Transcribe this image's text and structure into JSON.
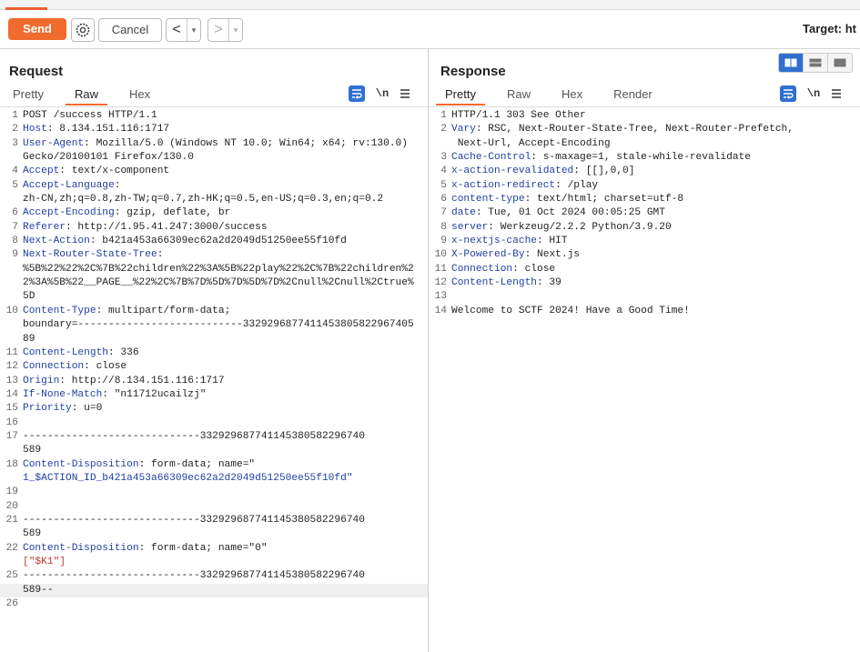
{
  "toolbar": {
    "send_label": "Send",
    "cancel_label": "Cancel",
    "back_arrow": "<",
    "forward_arrow": ">",
    "dropdown_glyph": "▾",
    "target_text": "Target: ht"
  },
  "request": {
    "title": "Request",
    "tabs": [
      "Pretty",
      "Raw",
      "Hex"
    ],
    "active_tab": "Raw",
    "newline_toggle": "\\n",
    "lines": [
      {
        "n": "1",
        "text": "POST /success HTTP/1.1"
      },
      {
        "n": "2",
        "name": "Host",
        "value": " 8.134.151.116:1717"
      },
      {
        "n": "3",
        "name": "User-Agent",
        "value": " Mozilla/5.0 (Windows NT 10.0; Win64; x64; rv:130.0) Gecko/20100101 Firefox/130.0"
      },
      {
        "n": "4",
        "name": "Accept",
        "value": " text/x-component"
      },
      {
        "n": "5",
        "name": "Accept-Language",
        "value": "\nzh-CN,zh;q=0.8,zh-TW;q=0.7,zh-HK;q=0.5,en-US;q=0.3,en;q=0.2"
      },
      {
        "n": "6",
        "name": "Accept-Encoding",
        "value": " gzip, deflate, br"
      },
      {
        "n": "7",
        "name": "Referer",
        "value": " http://1.95.41.247:3000/success"
      },
      {
        "n": "8",
        "name": "Next-Action",
        "value": " b421a453a66309ec62a2d2049d51250ee55f10fd"
      },
      {
        "n": "9",
        "name": "Next-Router-State-Tree",
        "value": "\n%5B%22%22%2C%7B%22children%22%3A%5B%22play%22%2C%7B%22children%22%3A%5B%22__PAGE__%22%2C%7B%7D%5D%7D%5D%7D%2Cnull%2Cnull%2Ctrue%5D"
      },
      {
        "n": "10",
        "name": "Content-Type",
        "value": " multipart/form-data;\nboundary=---------------------------332929687741145380582296740589"
      },
      {
        "n": "11",
        "name": "Content-Length",
        "value": " 336"
      },
      {
        "n": "12",
        "name": "Connection",
        "value": " close"
      },
      {
        "n": "13",
        "name": "Origin",
        "value": " http://8.134.151.116:1717"
      },
      {
        "n": "14",
        "name": "If-None-Match",
        "value": " \"n11712ucailzj\""
      },
      {
        "n": "15",
        "name": "Priority",
        "value": " u=0"
      },
      {
        "n": "16",
        "text": ""
      },
      {
        "n": "17",
        "text": "-----------------------------332929687741145380582296740\n589"
      },
      {
        "n": "18",
        "name": "Content-Disposition",
        "value": " form-data; name=\"",
        "blue": "\n1_$ACTION_ID_b421a453a66309ec62a2d2049d51250ee55f10fd\""
      },
      {
        "n": "19",
        "text": ""
      },
      {
        "n": "20",
        "text": ""
      },
      {
        "n": "21",
        "text": "-----------------------------332929687741145380582296740\n589"
      },
      {
        "n": "22",
        "name": "Content-Disposition",
        "value": " form-data; name=\"0\""
      },
      {
        "n": "",
        "red": "[\"$K1\"]"
      },
      {
        "n": "25",
        "text": "-----------------------------332929687741145380582296740"
      },
      {
        "n": "",
        "text": "589--",
        "highlight": true
      },
      {
        "n": "26",
        "text": ""
      }
    ]
  },
  "response": {
    "title": "Response",
    "tabs": [
      "Pretty",
      "Raw",
      "Hex",
      "Render"
    ],
    "active_tab": "Pretty",
    "newline_toggle": "\\n",
    "lines": [
      {
        "n": "1",
        "text": "HTTP/1.1 303 See Other"
      },
      {
        "n": "2",
        "name": "Vary",
        "value": " RSC, Next-Router-State-Tree, Next-Router-Prefetch,\n Next-Url, Accept-Encoding"
      },
      {
        "n": "3",
        "name": "Cache-Control",
        "value": " s-maxage=1, stale-while-revalidate"
      },
      {
        "n": "4",
        "name": "x-action-revalidated",
        "value": " [[],0,0]"
      },
      {
        "n": "5",
        "name": "x-action-redirect",
        "value": " /play"
      },
      {
        "n": "6",
        "name": "content-type",
        "value": " text/html; charset=utf-8"
      },
      {
        "n": "7",
        "name": "date",
        "value": " Tue, 01 Oct 2024 00:05:25 GMT"
      },
      {
        "n": "8",
        "name": "server",
        "value": " Werkzeug/2.2.2 Python/3.9.20"
      },
      {
        "n": "9",
        "name": "x-nextjs-cache",
        "value": " HIT"
      },
      {
        "n": "10",
        "name": "X-Powered-By",
        "value": " Next.js"
      },
      {
        "n": "11",
        "name": "Connection",
        "value": " close"
      },
      {
        "n": "12",
        "name": "Content-Length",
        "value": " 39"
      },
      {
        "n": "13",
        "text": ""
      },
      {
        "n": "14",
        "text": "Welcome to SCTF 2024! Have a Good Time!"
      }
    ]
  }
}
